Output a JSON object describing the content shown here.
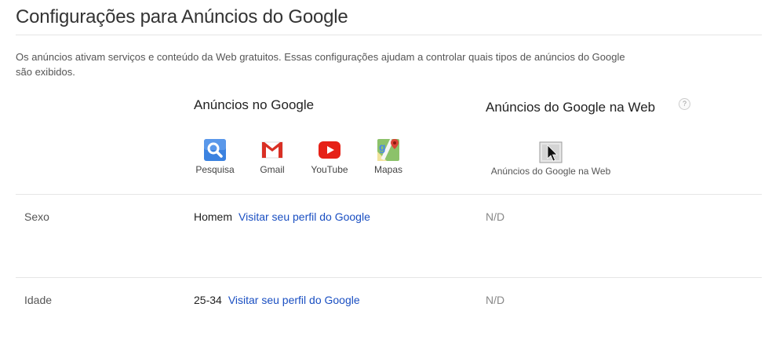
{
  "page": {
    "title": "Configurações para Anúncios do Google",
    "intro": "Os anúncios ativam serviços e conteúdo da Web gratuitos. Essas configurações ajudam a controlar quais tipos de anúncios do Google são exibidos."
  },
  "columns": {
    "google_heading": "Anúncios no Google",
    "web_heading": "Anúncios do Google na Web",
    "help_glyph": "?"
  },
  "products": [
    {
      "label": "Pesquisa",
      "icon": "search-icon"
    },
    {
      "label": "Gmail",
      "icon": "gmail-icon"
    },
    {
      "label": "YouTube",
      "icon": "youtube-icon"
    },
    {
      "label": "Mapas",
      "icon": "maps-icon"
    }
  ],
  "web_ads": {
    "label": "Anúncios do Google na Web",
    "icon": "cursor-icon"
  },
  "rows": [
    {
      "label": "Sexo",
      "value": "Homem",
      "link": "Visitar seu perfil do Google",
      "web_value": "N/D"
    },
    {
      "label": "Idade",
      "value": "25-34",
      "link": "Visitar seu perfil do Google",
      "web_value": "N/D"
    }
  ],
  "colors": {
    "link": "#1a4fc2",
    "divider": "#e5e5e5",
    "search_blue": "#3b82e0",
    "gmail_red": "#d93025",
    "youtube_red": "#e62117"
  }
}
